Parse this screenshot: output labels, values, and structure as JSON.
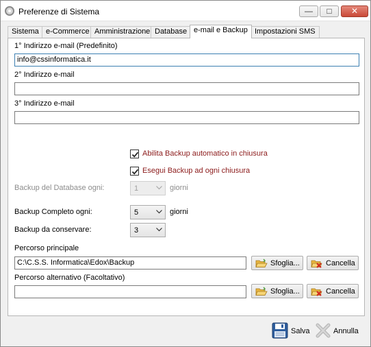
{
  "window": {
    "title": "Preferenze di Sistema",
    "minimize_label": "—",
    "maximize_label": "□",
    "close_label": "✕"
  },
  "tabs": [
    {
      "label": "Sistema"
    },
    {
      "label": "e-Commerce"
    },
    {
      "label": "Amministrazione"
    },
    {
      "label": "Database"
    },
    {
      "label": "e-mail e Backup",
      "active": true
    },
    {
      "label": "Impostazioni SMS"
    }
  ],
  "email": {
    "email1_label": "1° Indirizzo e-mail (Predefinito)",
    "email1_value": "info@cssinformatica.it",
    "email2_label": "2° Indirizzo e-mail",
    "email2_value": "",
    "email3_label": "3° Indirizzo e-mail",
    "email3_value": ""
  },
  "backup": {
    "auto_backup_label": "Abilita Backup automatico in chiusura",
    "auto_backup_checked": true,
    "every_close_label": "Esegui Backup ad ogni chiusura",
    "every_close_checked": true,
    "db_every_label": "Backup del Database ogni:",
    "db_every_value": "1",
    "db_every_unit": "giorni",
    "full_every_label": "Backup Completo ogni:",
    "full_every_value": "5",
    "full_every_unit": "giorni",
    "keep_label": "Backup da conservare:",
    "keep_value": "3"
  },
  "paths": {
    "main_label": "Percorso principale",
    "main_value": "C:\\C.S.S. Informatica\\Edox\\Backup",
    "alt_label": "Percorso alternativo (Facoltativo)",
    "alt_value": "",
    "browse_label": "Sfoglia...",
    "clear_label": "Cancella"
  },
  "footer": {
    "save_label": "Salva",
    "cancel_label": "Annulla"
  },
  "colors": {
    "checkbox_label": "#8b1a1a",
    "focus_border": "#3c7fb1",
    "close_button": "#c94a38"
  }
}
